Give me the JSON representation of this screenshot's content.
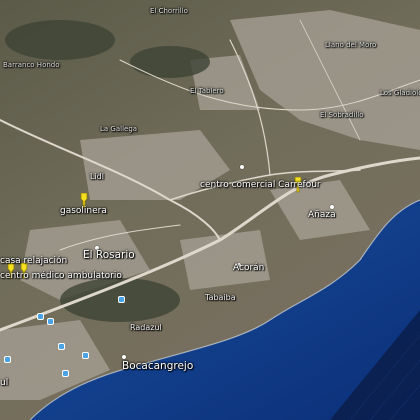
{
  "map": {
    "view": "satellite-3d",
    "colors": {
      "ocean": "#0e3a82",
      "ocean_deep": "#0a2a66",
      "land": "#6b6b55",
      "urban": "#a9a49a",
      "road": "#d8d4cc",
      "pin": "#f5e020"
    }
  },
  "labels": {
    "el_chorrillo": "El Chorrillo",
    "la_gallega": "La Gallega",
    "llano_del_moro": "Llano del Moro",
    "el_tablero": "El Tablero",
    "barranco_hondo": "Barranco Hondo",
    "lidl": "Lidl",
    "gasolinera": "gasolinera",
    "el_rosario": "El Rosario",
    "casa_relajacion": "casa relajación",
    "centro_medico": "centro médico ambulatorio",
    "cc_carrefour": "centro comercial Carrefour",
    "anaza": "Añaza",
    "acoran": "Acorán",
    "bocacangrejo": "Bocacangrejo",
    "tabaiba": "Tabaiba",
    "radazul": "Radazul",
    "el_sobradillo": "El Sobradillo",
    "los_gladiolos": "Los Gladiolos",
    "edge": "ul"
  }
}
